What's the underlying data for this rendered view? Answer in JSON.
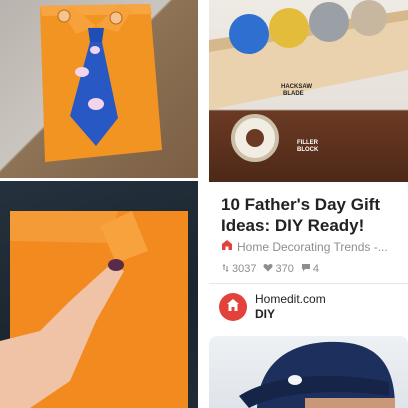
{
  "pins": {
    "shirt_card": {
      "image": "orange-shirt-card-with-blue-tie"
    },
    "folding_card": {
      "image": "folding-orange-paper-collar"
    },
    "tape_rack": {
      "image": "diy-tape-dispenser-rack",
      "labels": {
        "hacksaw": "HACKSAW\nBLADE",
        "filler": "FILLER\nBLOCK"
      }
    },
    "cap": {
      "image": "man-in-navy-cap"
    }
  },
  "featured_pin": {
    "title": "10 Father's Day Gift Ideas: DIY Ready!",
    "source": "Home Decorating Trends -...",
    "repins": "3037",
    "likes": "370",
    "comments": "4",
    "board_site": "Homedit.com",
    "board_name": "DIY",
    "colors": {
      "source_icon": "#e2423b",
      "avatar": "#e2423b",
      "meta": "#8e8e8e"
    }
  }
}
